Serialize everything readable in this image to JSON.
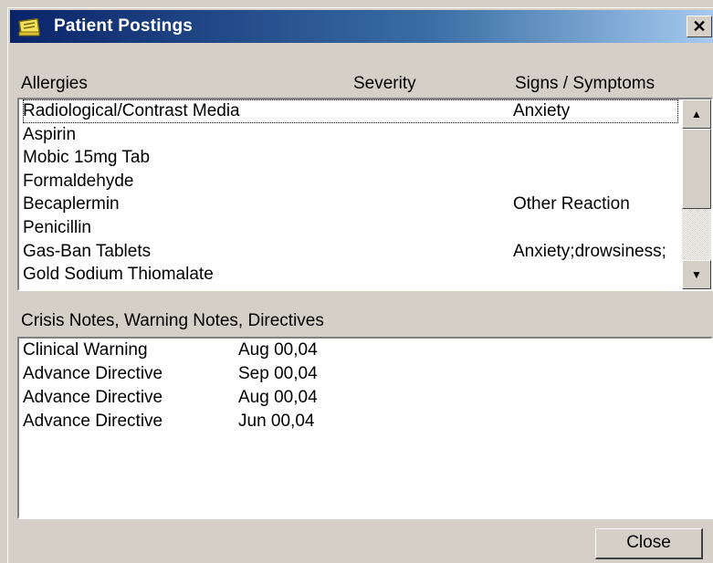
{
  "window": {
    "title": "Patient Postings",
    "close_glyph": "✕"
  },
  "allergies": {
    "columns": [
      "Allergies",
      "Severity",
      "Signs / Symptoms"
    ],
    "rows": [
      {
        "allergy": "Radiological/Contrast Media",
        "severity": "",
        "signs": "Anxiety"
      },
      {
        "allergy": "Aspirin",
        "severity": "",
        "signs": ""
      },
      {
        "allergy": "Mobic 15mg Tab",
        "severity": "",
        "signs": ""
      },
      {
        "allergy": "Formaldehyde",
        "severity": "",
        "signs": ""
      },
      {
        "allergy": "Becaplermin",
        "severity": "",
        "signs": "Other Reaction"
      },
      {
        "allergy": "Penicillin",
        "severity": "",
        "signs": ""
      },
      {
        "allergy": "Gas-Ban Tablets",
        "severity": "",
        "signs": "Anxiety;drowsiness;"
      },
      {
        "allergy": "Gold Sodium Thiomalate",
        "severity": "",
        "signs": ""
      }
    ]
  },
  "notes": {
    "label": "Crisis Notes, Warning Notes, Directives",
    "rows": [
      {
        "type": "Clinical Warning",
        "date": "Aug 00,04"
      },
      {
        "type": "Advance Directive",
        "date": "Sep 00,04"
      },
      {
        "type": "Advance Directive",
        "date": "Aug 00,04"
      },
      {
        "type": "Advance Directive",
        "date": "Jun 00,04"
      }
    ]
  },
  "buttons": {
    "close": "Close"
  },
  "colors": {
    "titlebar_start": "#0a246a",
    "titlebar_end": "#a6caf0",
    "face": "#d4d0c8"
  }
}
